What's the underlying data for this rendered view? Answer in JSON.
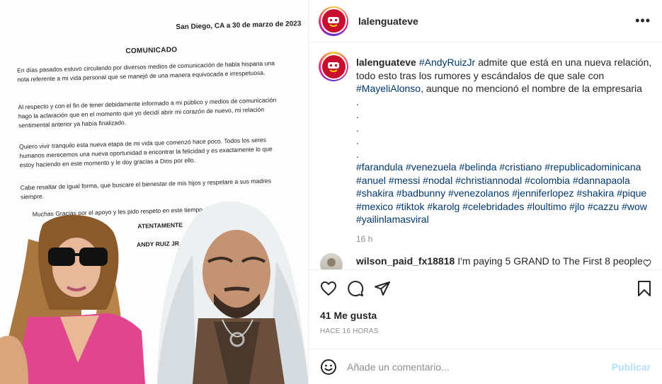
{
  "post_image": {
    "letter": {
      "date": "San Diego, CA a 30 de marzo de 2023",
      "heading": "COMUNICADO",
      "paragraphs": [
        "En días pasados estuvo circulando por diversos medios de comunicación de habla hispana una nota referente a mi vida personal que se manejó de una manera equivocada e irrespetuosa.",
        "Al respecto y con el fin de tener debidamente informado a mi público y medios de comunicación hago la aclaración que en el momento que yo decidí abrir mi corazón de nuevo, mi relación sentimental anterior ya había finalizado.",
        "Quiero vivir tranquilo esta nueva etapa de mi vida que comenzó hace poco. Todos los seres humanos merecemos una nueva oportunidad a encontrar la felicidad y es exactamente lo que estoy haciendo en este momento y le doy gracias a Dios por ello.",
        "Cabe resaltar de igual forma, que buscare el bienestar de mis hijos y respetare a sus madres siempre.",
        "Muchas Gracias por el apoyo y les pido respeto en este tiempo de vida."
      ],
      "closing": "ATENTAMENTE",
      "signature": "ANDY RUIZ JR."
    }
  },
  "header": {
    "username": "lalenguateve",
    "more_icon": "more-horizontal-icon"
  },
  "caption": {
    "username": "lalenguateve",
    "mention": "#AndyRuizJr",
    "text1": " admite que está en una nueva relación, todo esto tras los rumores y escándalos de que sale con ",
    "mention2": "#MayeliAlonso",
    "text2": ", aunque no mencionó el nombre de la empresaria",
    "dots": [
      ".",
      ".",
      ".",
      ".",
      "."
    ],
    "hashtags": "#farandula #venezuela #belinda #cristiano #republicadominicana #anuel #messi #nodal #christiannodal #colombia #dannapaola #shakira #badbunny #venezolanos #jenniferlopez #shakira #pique #mexico #tiktok #karolg #celebridades #loultimo #jlo #cazzu #wow #yailinlamasviral",
    "time": "16 h"
  },
  "comment": {
    "username": "wilson_paid_fx18818",
    "text": "I'm paying 5 GRAND to The First 8 people"
  },
  "actions": {
    "likes": "41 Me gusta",
    "posted_ago": "HACE 16 HORAS",
    "icons": [
      "heart-icon",
      "comment-icon",
      "share-icon",
      "bookmark-icon"
    ]
  },
  "add_comment": {
    "placeholder": "Añade un comentario...",
    "post_label": "Publicar",
    "emoji_icon": "emoji-icon"
  }
}
